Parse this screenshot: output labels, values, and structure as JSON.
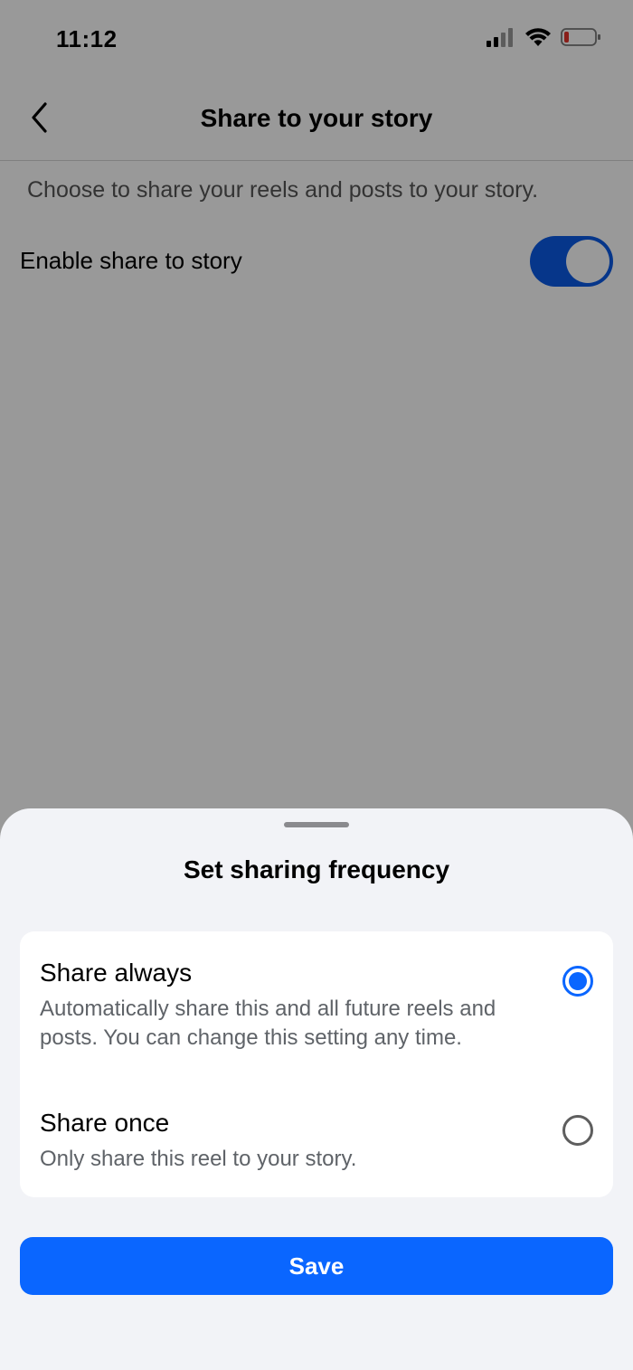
{
  "status_bar": {
    "time": "11:12",
    "icons": [
      "signal-icon",
      "wifi-icon",
      "battery-low-icon"
    ],
    "battery_color": "#e5332a"
  },
  "header": {
    "back_icon": "chevron-left-icon",
    "title": "Share to your story"
  },
  "main": {
    "description": "Choose to share your reels and posts to your story.",
    "toggle_label": "Enable share to story",
    "toggle_on": true,
    "toggle_color": "#0a5ae6"
  },
  "sheet": {
    "title": "Set sharing frequency",
    "options": [
      {
        "title": "Share always",
        "description": "Automatically share this and all future reels and posts. You can change this setting any time.",
        "selected": true
      },
      {
        "title": "Share once",
        "description": "Only share this reel to your story.",
        "selected": false
      }
    ],
    "save_label": "Save",
    "accent_color": "#0a66ff"
  }
}
